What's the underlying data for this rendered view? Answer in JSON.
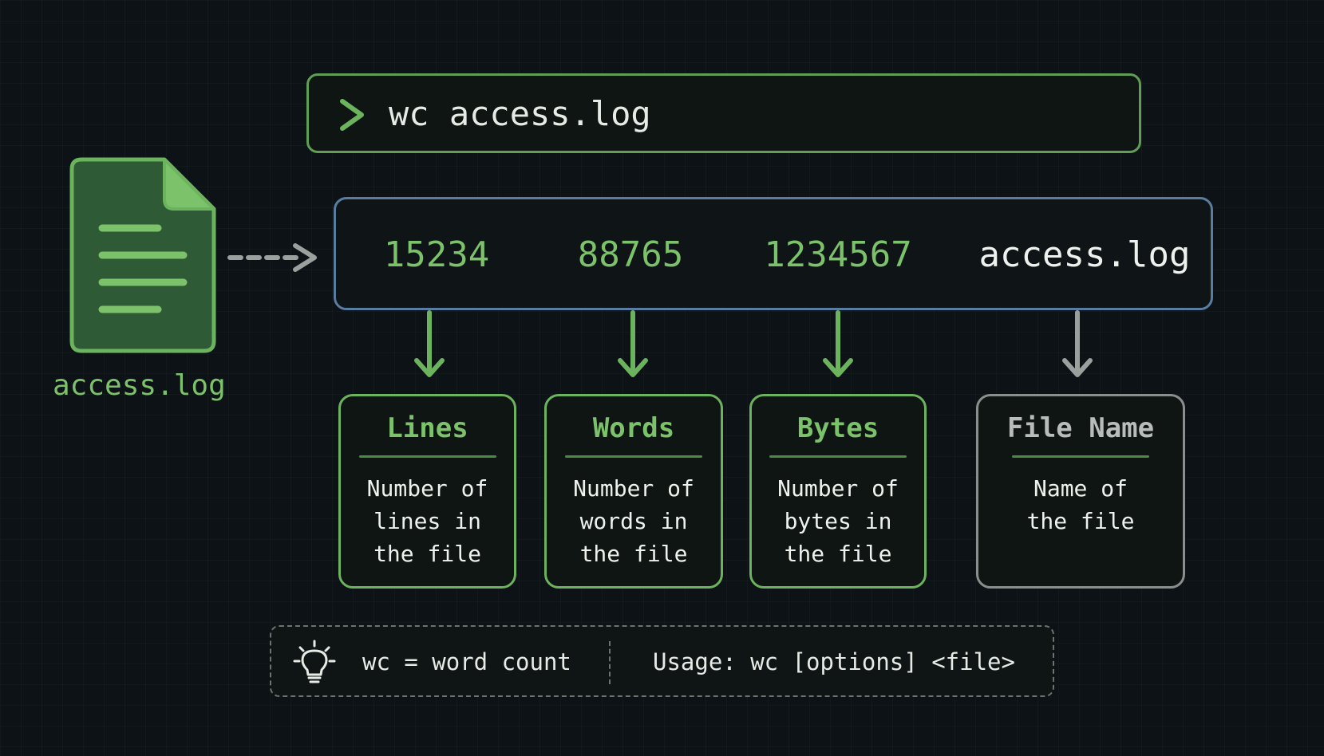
{
  "command": {
    "prompt_icon": "chevron-right-icon",
    "text": "wc access.log"
  },
  "input_file": {
    "icon": "document-icon",
    "label": "access.log"
  },
  "output": {
    "lines": "15234",
    "words": "88765",
    "bytes": "1234567",
    "filename": "access.log"
  },
  "fields": [
    {
      "title": "Lines",
      "desc": "Number of lines in the file"
    },
    {
      "title": "Words",
      "desc": "Number of words in the file"
    },
    {
      "title": "Bytes",
      "desc": "Number of bytes in the file"
    },
    {
      "title": "File Name",
      "desc": "Name of the file"
    }
  ],
  "tip": {
    "icon": "lightbulb-icon",
    "definition": "wc = word count",
    "usage": "Usage: wc [options] <file>"
  },
  "colors": {
    "background": "#0d1216",
    "accent_green": "#7cc26a",
    "border_green": "#6bb35c",
    "border_blue": "#5a7ca0",
    "neutral_gray": "#8a8f8e"
  }
}
